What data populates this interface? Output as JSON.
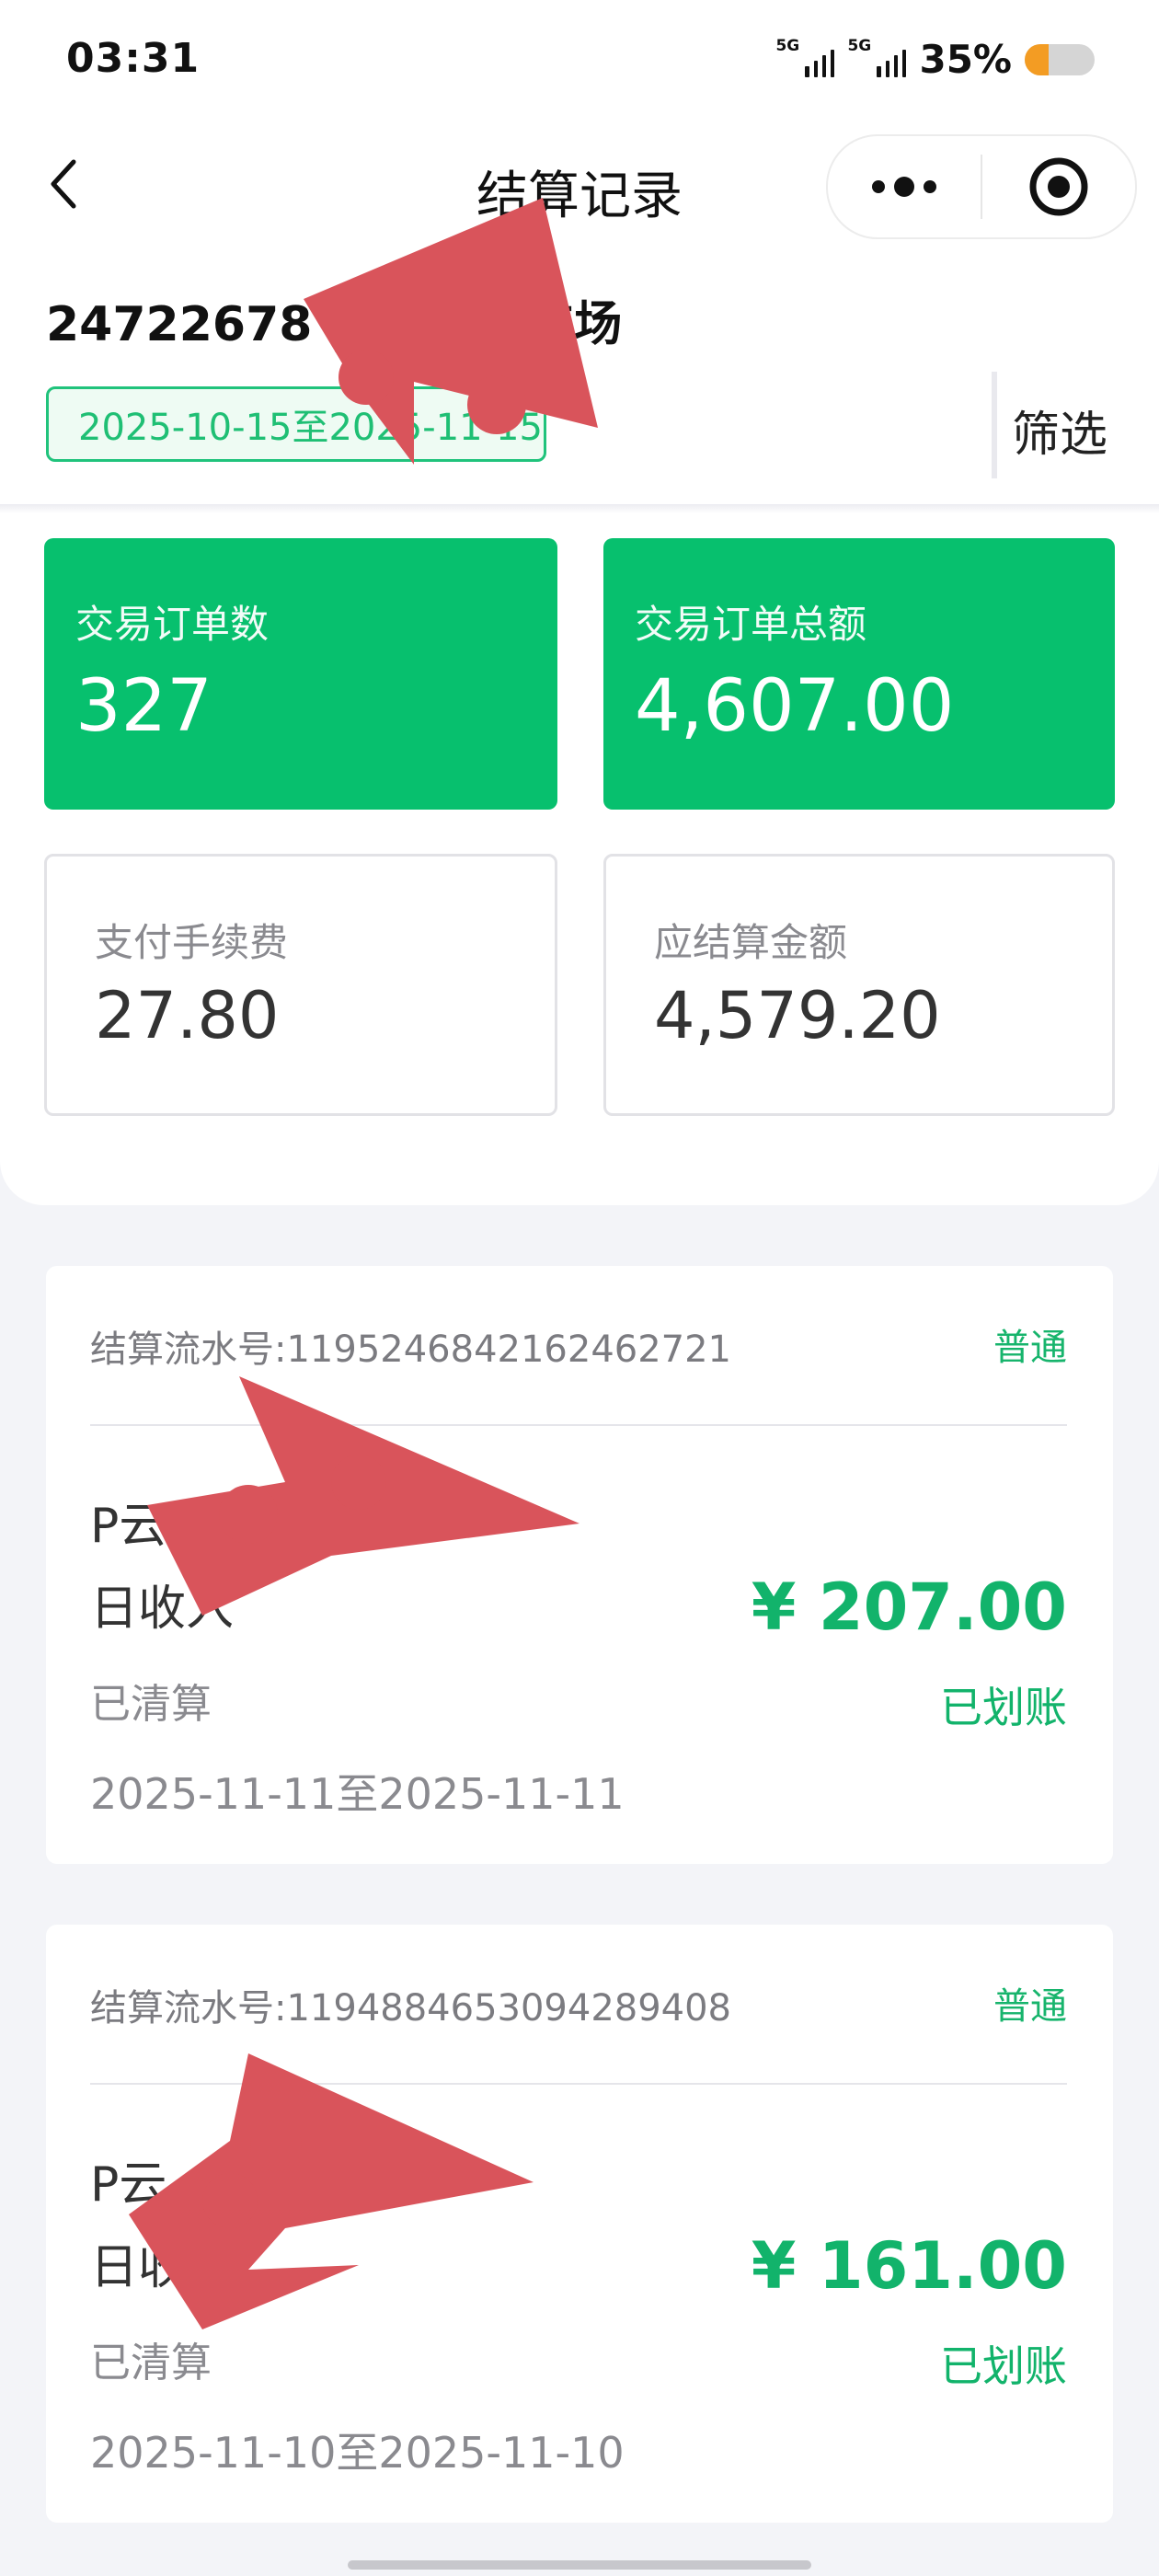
{
  "status_bar": {
    "time": "03:31",
    "net1": "5G",
    "net2": "5G",
    "battery": "35%",
    "battery_level": 0.35
  },
  "nav": {
    "title": "结算记录"
  },
  "merchant": {
    "name": "24722678 |          大厦-停车场"
  },
  "filter": {
    "date_range": "2025-10-15至2025-11-15",
    "filter_label": "筛选"
  },
  "stats": {
    "order_count_label": "交易订单数",
    "order_count": "327",
    "order_total_label": "交易订单总额",
    "order_total": "4,607.00",
    "fee_label": "支付手续费",
    "fee": "27.80",
    "settle_label": "应结算金额",
    "settle": "4,579.20"
  },
  "settlements": [
    {
      "serial": "结算流水号:1195246842162462721",
      "type": "普通",
      "title1": "P云               11月11日",
      "title2": "日收入",
      "status": "已清算",
      "amount": "¥ 207.00",
      "transfer": "已划账",
      "period": "2025-11-11至2025-11-11"
    },
    {
      "serial": "结算流水号:1194884653094289408",
      "type": "普通",
      "title1": "P云-               11月10日",
      "title2": "日收入",
      "status": "已清算",
      "amount": "¥ 161.00",
      "transfer": "已划账",
      "period": "2025-11-10至2025-11-10"
    }
  ],
  "colors": {
    "accent_green": "#07c06e",
    "redaction": "#d9545b"
  }
}
